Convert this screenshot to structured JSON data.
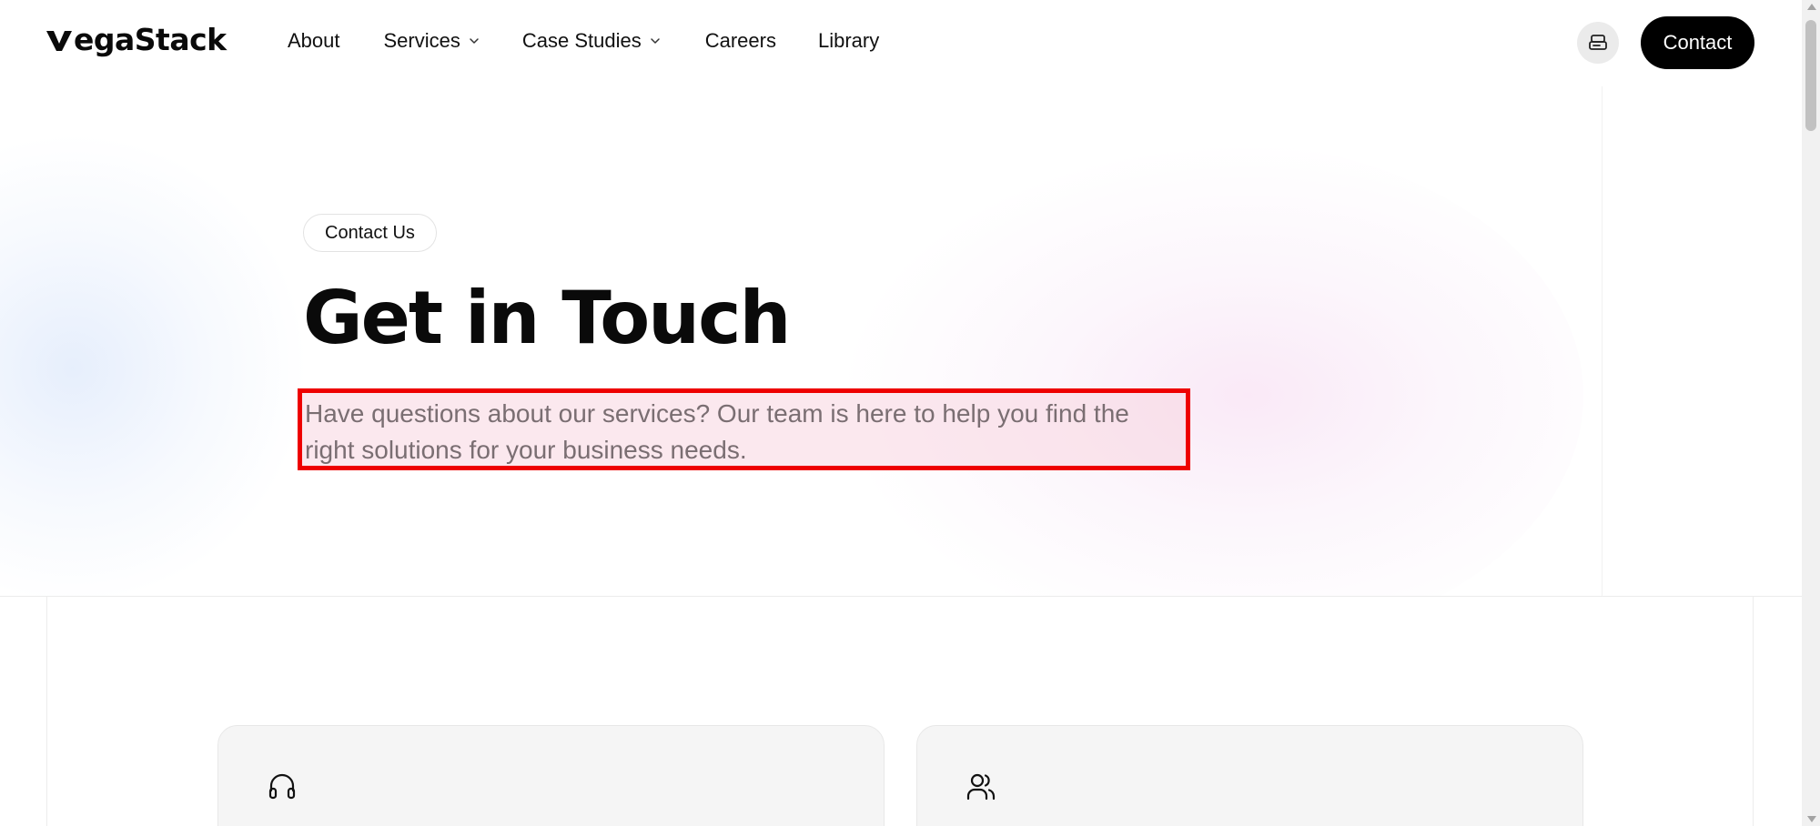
{
  "brand": {
    "name": "VegaStack",
    "logo_rest": "egaStack"
  },
  "nav": {
    "items": [
      {
        "label": "About",
        "has_dropdown": false
      },
      {
        "label": "Services",
        "has_dropdown": true
      },
      {
        "label": "Case Studies",
        "has_dropdown": true
      },
      {
        "label": "Careers",
        "has_dropdown": false
      },
      {
        "label": "Library",
        "has_dropdown": false
      }
    ],
    "theme_icon": "printer-icon",
    "cta_label": "Contact"
  },
  "hero": {
    "badge": "Contact Us",
    "title": "Get in Touch",
    "subtitle": "Have questions about our services? Our team is here to help you find the right solutions for your business needs.",
    "highlight_color": "#ee0000"
  },
  "cards": [
    {
      "icon": "headphones-icon"
    },
    {
      "icon": "users-icon"
    }
  ],
  "colors": {
    "accent": "#000000",
    "background": "#ffffff",
    "card_bg": "#f5f5f5"
  }
}
